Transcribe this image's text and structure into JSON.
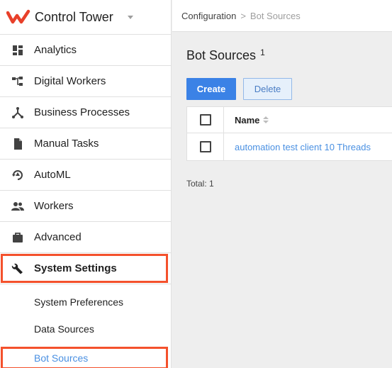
{
  "app": {
    "title": "Control Tower"
  },
  "sidebar": {
    "items": [
      {
        "label": "Analytics",
        "icon": "dashboard-icon"
      },
      {
        "label": "Digital Workers",
        "icon": "hierarchy-icon"
      },
      {
        "label": "Business Processes",
        "icon": "process-icon"
      },
      {
        "label": "Manual Tasks",
        "icon": "document-icon"
      },
      {
        "label": "AutoML",
        "icon": "automl-icon"
      },
      {
        "label": "Workers",
        "icon": "people-icon"
      },
      {
        "label": "Advanced",
        "icon": "briefcase-icon"
      },
      {
        "label": "System Settings",
        "icon": "wrench-icon"
      }
    ],
    "subitems": [
      {
        "label": "System Preferences"
      },
      {
        "label": "Data Sources"
      },
      {
        "label": "Bot Sources"
      }
    ]
  },
  "breadcrumb": {
    "parent": "Configuration",
    "separator": ">",
    "current": "Bot Sources"
  },
  "page": {
    "title": "Bot Sources",
    "count": "1"
  },
  "toolbar": {
    "create_label": "Create",
    "delete_label": "Delete"
  },
  "table": {
    "header": {
      "name": "Name"
    },
    "rows": [
      {
        "name": "automation test client 10 Threads"
      }
    ]
  },
  "footer": {
    "total": "Total: 1"
  },
  "colors": {
    "accent": "#3b82e6",
    "highlight": "#f4512c",
    "link": "#4a90e2",
    "brand": "#e8402a"
  }
}
